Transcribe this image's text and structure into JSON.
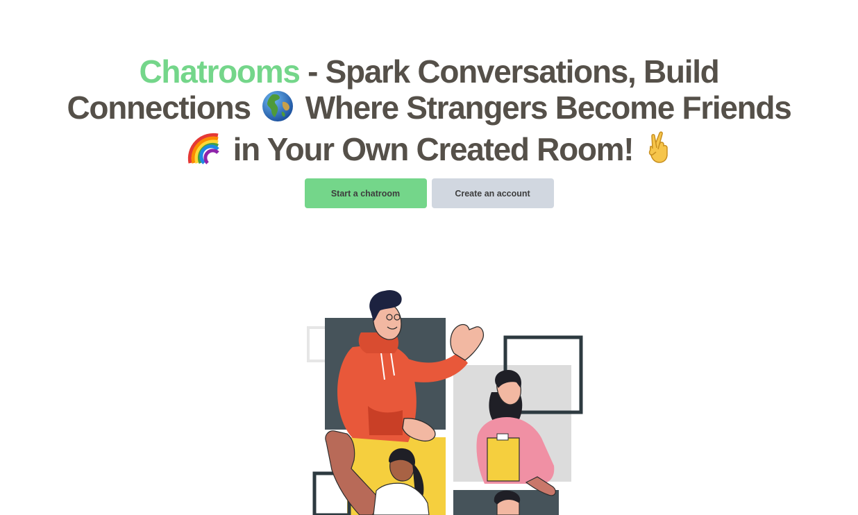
{
  "hero": {
    "brand": "Chatrooms",
    "line1_rest": " - Spark Conversations, Build",
    "line2_a": "Connections ",
    "line2_b": " Where Strangers Become Friends",
    "line3": " in Your Own Created Room! "
  },
  "actions": {
    "start_label": "Start a chatroom",
    "account_label": "Create an account"
  },
  "colors": {
    "brand": "#74d68a",
    "heading": "#555049",
    "secondary_button": "#d1d7e0"
  },
  "icons": [
    "globe-icon",
    "rainbow-icon",
    "crossed-fingers-icon"
  ]
}
